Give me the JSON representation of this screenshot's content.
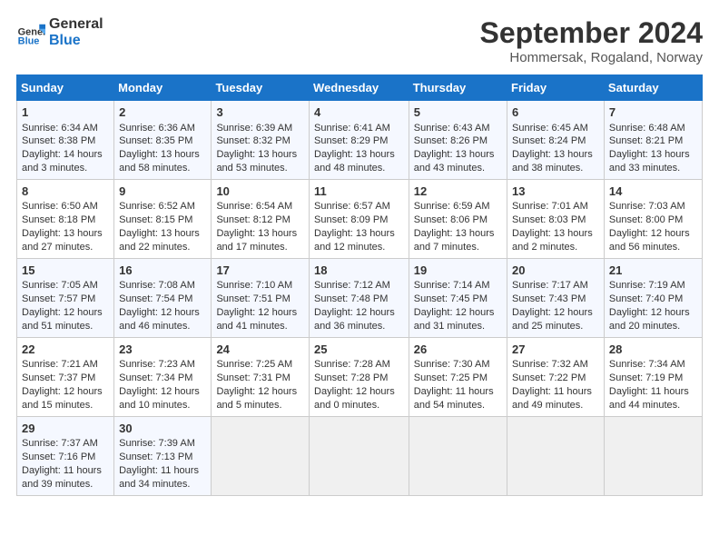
{
  "header": {
    "logo_general": "General",
    "logo_blue": "Blue",
    "month_year": "September 2024",
    "location": "Hommersak, Rogaland, Norway"
  },
  "days_of_week": [
    "Sunday",
    "Monday",
    "Tuesday",
    "Wednesday",
    "Thursday",
    "Friday",
    "Saturday"
  ],
  "weeks": [
    [
      {
        "day": "1",
        "lines": [
          "Sunrise: 6:34 AM",
          "Sunset: 8:38 PM",
          "Daylight: 14 hours",
          "and 3 minutes."
        ]
      },
      {
        "day": "2",
        "lines": [
          "Sunrise: 6:36 AM",
          "Sunset: 8:35 PM",
          "Daylight: 13 hours",
          "and 58 minutes."
        ]
      },
      {
        "day": "3",
        "lines": [
          "Sunrise: 6:39 AM",
          "Sunset: 8:32 PM",
          "Daylight: 13 hours",
          "and 53 minutes."
        ]
      },
      {
        "day": "4",
        "lines": [
          "Sunrise: 6:41 AM",
          "Sunset: 8:29 PM",
          "Daylight: 13 hours",
          "and 48 minutes."
        ]
      },
      {
        "day": "5",
        "lines": [
          "Sunrise: 6:43 AM",
          "Sunset: 8:26 PM",
          "Daylight: 13 hours",
          "and 43 minutes."
        ]
      },
      {
        "day": "6",
        "lines": [
          "Sunrise: 6:45 AM",
          "Sunset: 8:24 PM",
          "Daylight: 13 hours",
          "and 38 minutes."
        ]
      },
      {
        "day": "7",
        "lines": [
          "Sunrise: 6:48 AM",
          "Sunset: 8:21 PM",
          "Daylight: 13 hours",
          "and 33 minutes."
        ]
      }
    ],
    [
      {
        "day": "8",
        "lines": [
          "Sunrise: 6:50 AM",
          "Sunset: 8:18 PM",
          "Daylight: 13 hours",
          "and 27 minutes."
        ]
      },
      {
        "day": "9",
        "lines": [
          "Sunrise: 6:52 AM",
          "Sunset: 8:15 PM",
          "Daylight: 13 hours",
          "and 22 minutes."
        ]
      },
      {
        "day": "10",
        "lines": [
          "Sunrise: 6:54 AM",
          "Sunset: 8:12 PM",
          "Daylight: 13 hours",
          "and 17 minutes."
        ]
      },
      {
        "day": "11",
        "lines": [
          "Sunrise: 6:57 AM",
          "Sunset: 8:09 PM",
          "Daylight: 13 hours",
          "and 12 minutes."
        ]
      },
      {
        "day": "12",
        "lines": [
          "Sunrise: 6:59 AM",
          "Sunset: 8:06 PM",
          "Daylight: 13 hours",
          "and 7 minutes."
        ]
      },
      {
        "day": "13",
        "lines": [
          "Sunrise: 7:01 AM",
          "Sunset: 8:03 PM",
          "Daylight: 13 hours",
          "and 2 minutes."
        ]
      },
      {
        "day": "14",
        "lines": [
          "Sunrise: 7:03 AM",
          "Sunset: 8:00 PM",
          "Daylight: 12 hours",
          "and 56 minutes."
        ]
      }
    ],
    [
      {
        "day": "15",
        "lines": [
          "Sunrise: 7:05 AM",
          "Sunset: 7:57 PM",
          "Daylight: 12 hours",
          "and 51 minutes."
        ]
      },
      {
        "day": "16",
        "lines": [
          "Sunrise: 7:08 AM",
          "Sunset: 7:54 PM",
          "Daylight: 12 hours",
          "and 46 minutes."
        ]
      },
      {
        "day": "17",
        "lines": [
          "Sunrise: 7:10 AM",
          "Sunset: 7:51 PM",
          "Daylight: 12 hours",
          "and 41 minutes."
        ]
      },
      {
        "day": "18",
        "lines": [
          "Sunrise: 7:12 AM",
          "Sunset: 7:48 PM",
          "Daylight: 12 hours",
          "and 36 minutes."
        ]
      },
      {
        "day": "19",
        "lines": [
          "Sunrise: 7:14 AM",
          "Sunset: 7:45 PM",
          "Daylight: 12 hours",
          "and 31 minutes."
        ]
      },
      {
        "day": "20",
        "lines": [
          "Sunrise: 7:17 AM",
          "Sunset: 7:43 PM",
          "Daylight: 12 hours",
          "and 25 minutes."
        ]
      },
      {
        "day": "21",
        "lines": [
          "Sunrise: 7:19 AM",
          "Sunset: 7:40 PM",
          "Daylight: 12 hours",
          "and 20 minutes."
        ]
      }
    ],
    [
      {
        "day": "22",
        "lines": [
          "Sunrise: 7:21 AM",
          "Sunset: 7:37 PM",
          "Daylight: 12 hours",
          "and 15 minutes."
        ]
      },
      {
        "day": "23",
        "lines": [
          "Sunrise: 7:23 AM",
          "Sunset: 7:34 PM",
          "Daylight: 12 hours",
          "and 10 minutes."
        ]
      },
      {
        "day": "24",
        "lines": [
          "Sunrise: 7:25 AM",
          "Sunset: 7:31 PM",
          "Daylight: 12 hours",
          "and 5 minutes."
        ]
      },
      {
        "day": "25",
        "lines": [
          "Sunrise: 7:28 AM",
          "Sunset: 7:28 PM",
          "Daylight: 12 hours",
          "and 0 minutes."
        ]
      },
      {
        "day": "26",
        "lines": [
          "Sunrise: 7:30 AM",
          "Sunset: 7:25 PM",
          "Daylight: 11 hours",
          "and 54 minutes."
        ]
      },
      {
        "day": "27",
        "lines": [
          "Sunrise: 7:32 AM",
          "Sunset: 7:22 PM",
          "Daylight: 11 hours",
          "and 49 minutes."
        ]
      },
      {
        "day": "28",
        "lines": [
          "Sunrise: 7:34 AM",
          "Sunset: 7:19 PM",
          "Daylight: 11 hours",
          "and 44 minutes."
        ]
      }
    ],
    [
      {
        "day": "29",
        "lines": [
          "Sunrise: 7:37 AM",
          "Sunset: 7:16 PM",
          "Daylight: 11 hours",
          "and 39 minutes."
        ]
      },
      {
        "day": "30",
        "lines": [
          "Sunrise: 7:39 AM",
          "Sunset: 7:13 PM",
          "Daylight: 11 hours",
          "and 34 minutes."
        ]
      },
      {
        "day": "",
        "lines": []
      },
      {
        "day": "",
        "lines": []
      },
      {
        "day": "",
        "lines": []
      },
      {
        "day": "",
        "lines": []
      },
      {
        "day": "",
        "lines": []
      }
    ]
  ]
}
